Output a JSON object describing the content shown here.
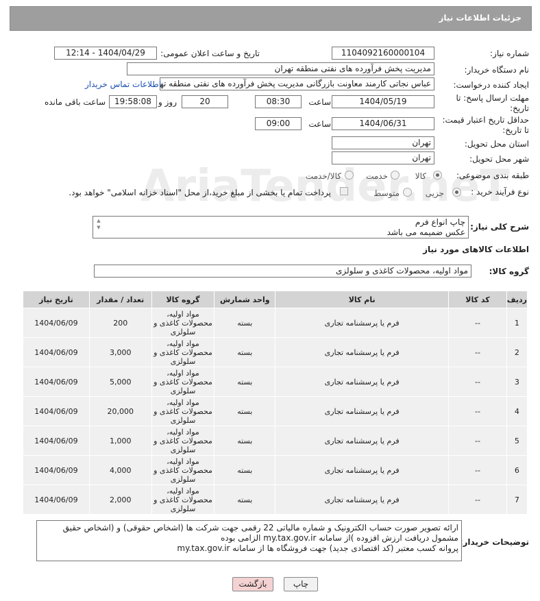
{
  "header": {
    "title": "جزئیات اطلاعات نیاز"
  },
  "watermark": "AriaTender.neT",
  "form": {
    "need_number_label": "شماره نیاز:",
    "need_number": "1104092160000104",
    "announce_label": "تاریخ و ساعت اعلان عمومی:",
    "announce_value": "1404/04/29 - 12:14",
    "buyer_org_label": "نام دستگاه خریدار:",
    "buyer_org": "مدیریت پخش فرآورده های نفتی منطقه تهران",
    "creator_label": "ایجاد کننده درخواست:",
    "creator": "عباس نجاتی کارمند معاونت بازرگانی مدیریت پخش فرآورده های نفتی منطقه تهران",
    "contact_link": "اطلاعات تماس خریدار",
    "reply_deadline_label": "مهلت ارسال پاسخ: تا تاریخ:",
    "reply_date": "1404/05/19",
    "time_label": "ساعت",
    "reply_time": "08:30",
    "days_value": "20",
    "days_label": "روز و",
    "remaining_time": "19:58:08",
    "remaining_label": "ساعت باقی مانده",
    "price_deadline_label": "حداقل تاریخ اعتبار قیمت: تا تاریخ:",
    "price_date": "1404/06/31",
    "price_time": "09:00",
    "province_label": "استان محل تحویل:",
    "province": "تهران",
    "city_label": "شهر محل تحویل:",
    "city": "تهران",
    "category_label": "طبقه بندی موضوعی:",
    "category_options": [
      "کالا",
      "خدمت",
      "کالا/خدمت"
    ],
    "process_label": "نوع فرآیند خرید :",
    "process_options": [
      "جزیی",
      "متوسط"
    ],
    "process_note": "پرداخت تمام یا بخشی از مبلغ خرید،از محل \"اسناد خزانه اسلامی\" خواهد بود.",
    "description_label": "شرح کلی نیاز:",
    "description_line1": "چاپ انواع  فرم",
    "description_line2": "عکس ضمیمه می باشد"
  },
  "goods": {
    "section_title": "اطلاعات کالاهای مورد نیاز",
    "group_label": "گروه کالا:",
    "group_value": "مواد اولیه، محصولات کاغذی و سلولزی"
  },
  "table": {
    "headers": [
      "ردیف",
      "کد کالا",
      "نام کالا",
      "واحد شمارش",
      "گروه کالا",
      "تعداد / مقدار",
      "تاریخ نیاز"
    ],
    "rows": [
      {
        "idx": "1",
        "code": "--",
        "name": "فرم یا پرسشنامه تجاری",
        "unit": "بسته",
        "group": "مواد اولیه، محصولات کاغذی و سلولزی",
        "qty": "200",
        "date": "1404/06/09"
      },
      {
        "idx": "2",
        "code": "--",
        "name": "فرم یا پرسشنامه تجاری",
        "unit": "بسته",
        "group": "مواد اولیه، محصولات کاغذی و سلولزی",
        "qty": "3,000",
        "date": "1404/06/09"
      },
      {
        "idx": "3",
        "code": "--",
        "name": "فرم یا پرسشنامه تجاری",
        "unit": "بسته",
        "group": "مواد اولیه، محصولات کاغذی و سلولزی",
        "qty": "5,000",
        "date": "1404/06/09"
      },
      {
        "idx": "4",
        "code": "--",
        "name": "فرم یا پرسشنامه تجاری",
        "unit": "بسته",
        "group": "مواد اولیه، محصولات کاغذی و سلولزی",
        "qty": "20,000",
        "date": "1404/06/09"
      },
      {
        "idx": "5",
        "code": "--",
        "name": "فرم یا پرسشنامه تجاری",
        "unit": "بسته",
        "group": "مواد اولیه، محصولات کاغذی و سلولزی",
        "qty": "1,000",
        "date": "1404/06/09"
      },
      {
        "idx": "6",
        "code": "--",
        "name": "فرم یا پرسشنامه تجاری",
        "unit": "بسته",
        "group": "مواد اولیه، محصولات کاغذی و سلولزی",
        "qty": "4,000",
        "date": "1404/06/09"
      },
      {
        "idx": "7",
        "code": "--",
        "name": "فرم یا پرسشنامه تجاری",
        "unit": "بسته",
        "group": "مواد اولیه، محصولات کاغذی و سلولزی",
        "qty": "2,000",
        "date": "1404/06/09"
      }
    ]
  },
  "buyer_notes": {
    "label": "توضیحات خریدار:",
    "line1": "ارائه  تصویر صورت حساب الکترونیک و شماره مالیاتی 22 رقمی  جهت شرکت ها (اشخاص حقوقی) و (اشخاص حقیق",
    "line2": "مشمول دریافت ارزش افزوده )از سامانه  my.tax.gov.ir  الزامی بوده",
    "line3": "پروانه کسب معتبر (کد اقتصادی جدید) جهت فروشگاه ها از سامانه my.tax.gov.ir"
  },
  "buttons": {
    "print": "چاپ",
    "back": "بازگشت"
  }
}
